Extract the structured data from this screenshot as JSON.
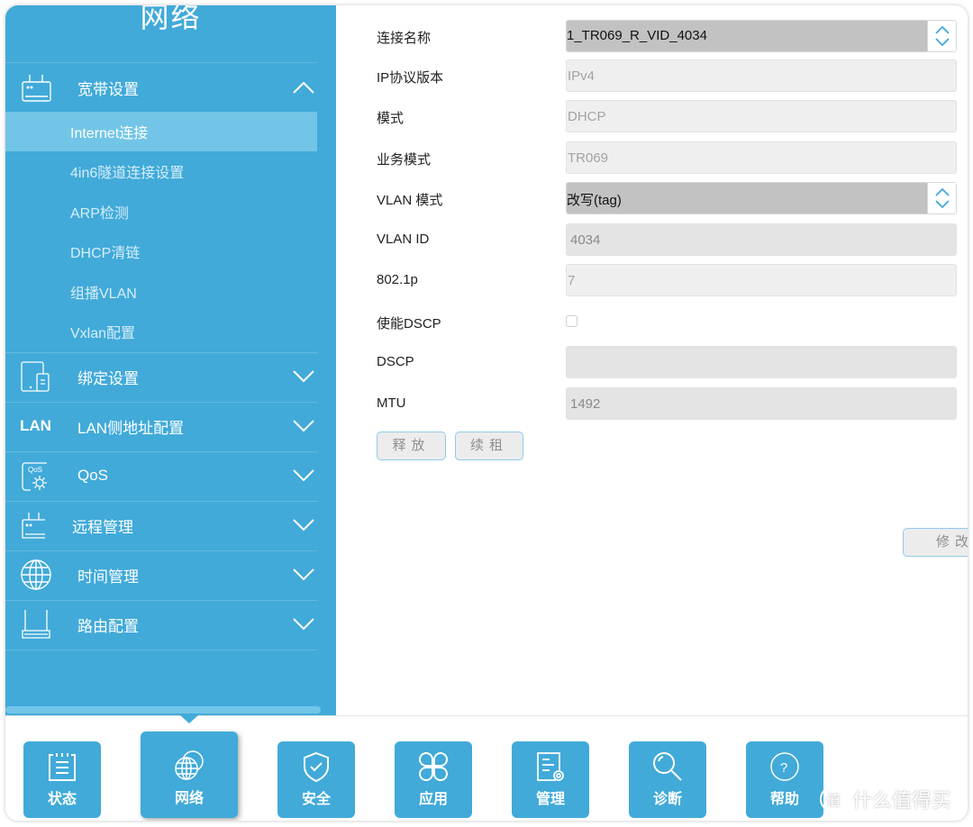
{
  "sidebar": {
    "title": "网络",
    "groups": [
      {
        "label": "宽带设置",
        "icon": "router-icon",
        "expanded": true,
        "items": [
          {
            "label": "Internet连接",
            "active": true
          },
          {
            "label": "4in6隧道连接设置"
          },
          {
            "label": "ARP检测"
          },
          {
            "label": "DHCP清链"
          },
          {
            "label": "组播VLAN"
          },
          {
            "label": "Vxlan配置"
          }
        ]
      },
      {
        "label": "绑定设置",
        "icon": "devices-icon",
        "expanded": false
      },
      {
        "label": "LAN侧地址配置",
        "icon": "lan-icon",
        "icon_text": "LAN",
        "expanded": false
      },
      {
        "label": "QoS",
        "icon": "qos-gear-icon",
        "icon_text": "QoS",
        "expanded": false
      },
      {
        "label": "远程管理",
        "icon": "remote-router-icon",
        "expanded": false
      },
      {
        "label": "时间管理",
        "icon": "globe-icon",
        "expanded": false
      },
      {
        "label": "路由配置",
        "icon": "router-base-icon",
        "expanded": false
      }
    ]
  },
  "form": {
    "connection_name": {
      "label": "连接名称",
      "value": "1_TR069_R_VID_4034"
    },
    "ip_version": {
      "label": "IP协议版本",
      "value": "IPv4"
    },
    "mode": {
      "label": "模式",
      "value": "DHCP"
    },
    "service_mode": {
      "label": "业务模式",
      "value": "TR069"
    },
    "vlan_mode": {
      "label": "VLAN 模式",
      "value": "改写(tag)"
    },
    "vlan_id": {
      "label": "VLAN ID",
      "value": "4034"
    },
    "dot1p": {
      "label": "802.1p",
      "value": "7"
    },
    "enable_dscp": {
      "label": "使能DSCP",
      "checked": false
    },
    "dscp": {
      "label": "DSCP",
      "value": ""
    },
    "mtu": {
      "label": "MTU",
      "value": "1492"
    },
    "release_label": "释放",
    "renew_label": "续租",
    "modify_label": "修改"
  },
  "nav": {
    "tabs": [
      {
        "label": "状态",
        "icon": "status-clipboard-icon"
      },
      {
        "label": "网络",
        "icon": "network-globe-icon",
        "active": true
      },
      {
        "label": "安全",
        "icon": "security-shield-icon"
      },
      {
        "label": "应用",
        "icon": "apps-grid-icon"
      },
      {
        "label": "管理",
        "icon": "manage-document-icon"
      },
      {
        "label": "诊断",
        "icon": "diagnose-search-icon"
      },
      {
        "label": "帮助",
        "icon": "help-icon"
      }
    ]
  },
  "watermark": {
    "badge": "值",
    "text": "什么值得买"
  },
  "colors": {
    "primary": "#41aad9",
    "active_item": "#72c5e6",
    "select_bg": "#c2c2c2"
  }
}
